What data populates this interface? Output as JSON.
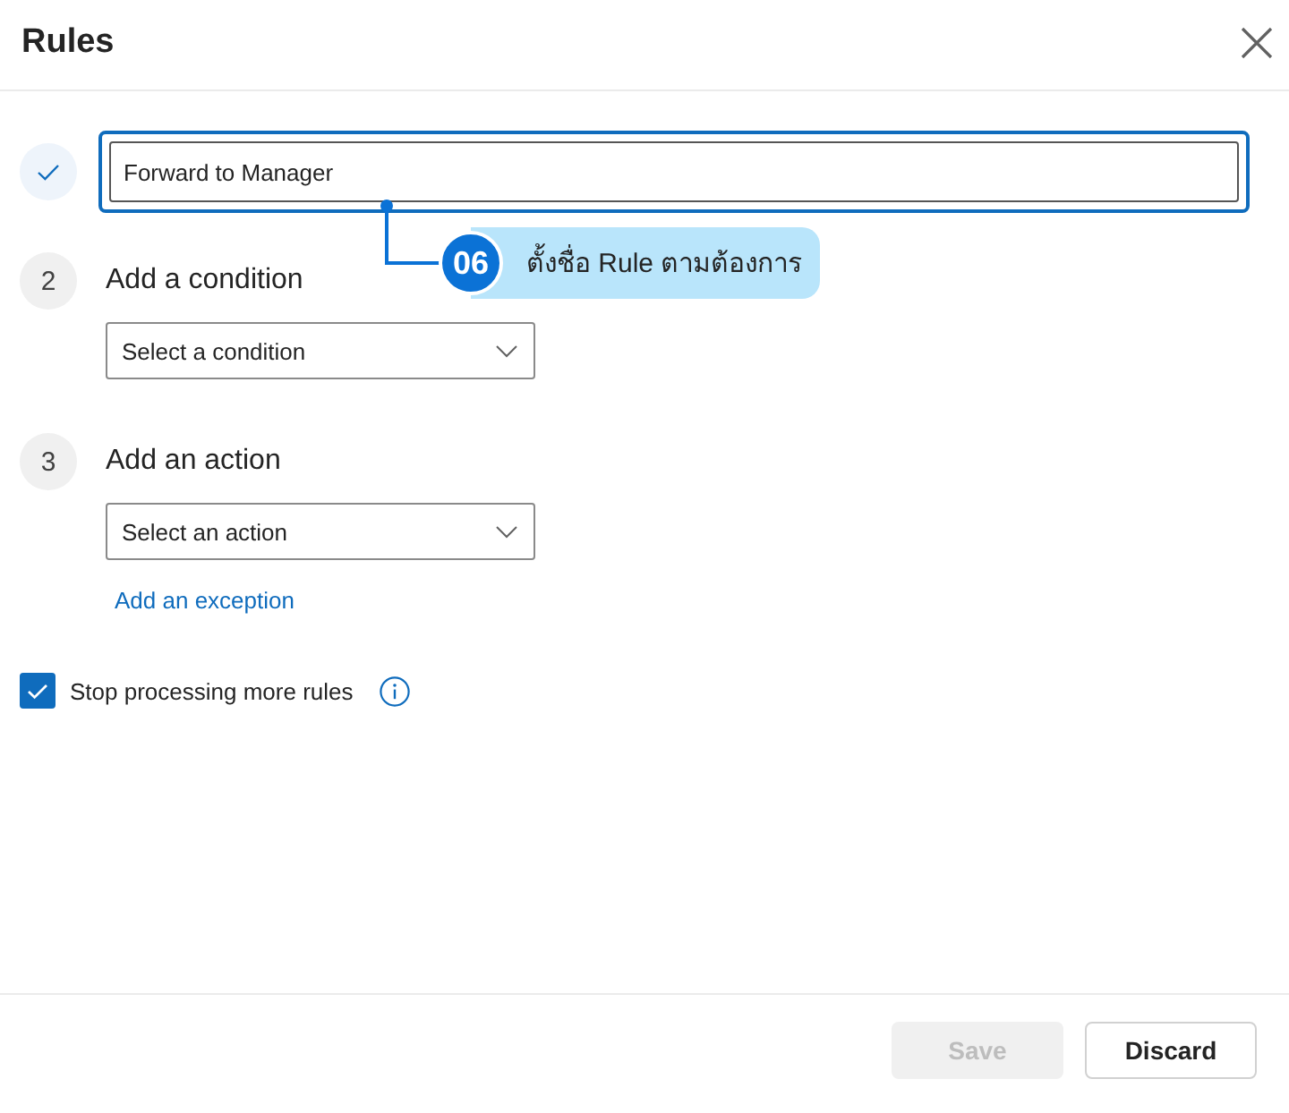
{
  "dialog": {
    "title": "Rules"
  },
  "steps": [
    {
      "kind": "name",
      "done": true,
      "field": {
        "value": "Forward to Manager",
        "focused": true
      }
    },
    {
      "kind": "condition",
      "done": false,
      "number": "2",
      "heading": "Add a condition",
      "dropdown": {
        "placeholder": "Select a condition"
      }
    },
    {
      "kind": "action",
      "done": false,
      "number": "3",
      "heading": "Add an action",
      "dropdown": {
        "placeholder": "Select an action"
      },
      "link": "Add an exception"
    }
  ],
  "stop_processing": {
    "label": "Stop processing more rules",
    "checked": true
  },
  "buttons": [
    {
      "label": "Save",
      "disabled": true,
      "kind": "primary"
    },
    {
      "label": "Discard",
      "disabled": false,
      "kind": "secondary"
    }
  ],
  "annotation": {
    "number": "06",
    "text": "ตั้งชื่อ Rule ตามต้องการ"
  }
}
